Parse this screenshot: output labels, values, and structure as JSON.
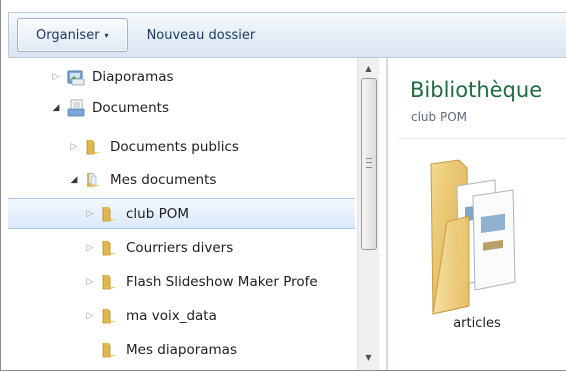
{
  "toolbar": {
    "organize_label": "Organiser",
    "organize_arrow": "▾",
    "new_folder_label": "Nouveau dossier"
  },
  "nav_tree": {
    "items": [
      {
        "label": "Diaporamas",
        "icon": "library-pictures-icon",
        "expander": "collapsed"
      },
      {
        "label": "Documents",
        "icon": "library-documents-icon",
        "expander": "expanded"
      },
      {
        "label": "Documents publics",
        "icon": "folder-icon",
        "expander": "collapsed"
      },
      {
        "label": "Mes documents",
        "icon": "folder-documents-icon",
        "expander": "expanded"
      },
      {
        "label": "club POM",
        "icon": "folder-icon",
        "expander": "collapsed",
        "selected": true
      },
      {
        "label": "Courriers divers",
        "icon": "folder-icon",
        "expander": "collapsed"
      },
      {
        "label": "Flash Slideshow Maker Profe",
        "icon": "folder-icon",
        "expander": "collapsed"
      },
      {
        "label": "ma voix_data",
        "icon": "folder-icon",
        "expander": "collapsed"
      },
      {
        "label": "Mes diaporamas",
        "icon": "folder-icon",
        "expander": "none"
      }
    ]
  },
  "content": {
    "library_title": "Bibliothèque",
    "library_subtitle": "club POM",
    "items": [
      {
        "label": "articles",
        "icon": "folder-with-documents-icon"
      }
    ]
  },
  "colors": {
    "library_title": "#1e6b3d",
    "selection_fill": "#dbe9f9",
    "selection_border": "#a8c8ea",
    "command_bar": "#dfe8f4"
  }
}
